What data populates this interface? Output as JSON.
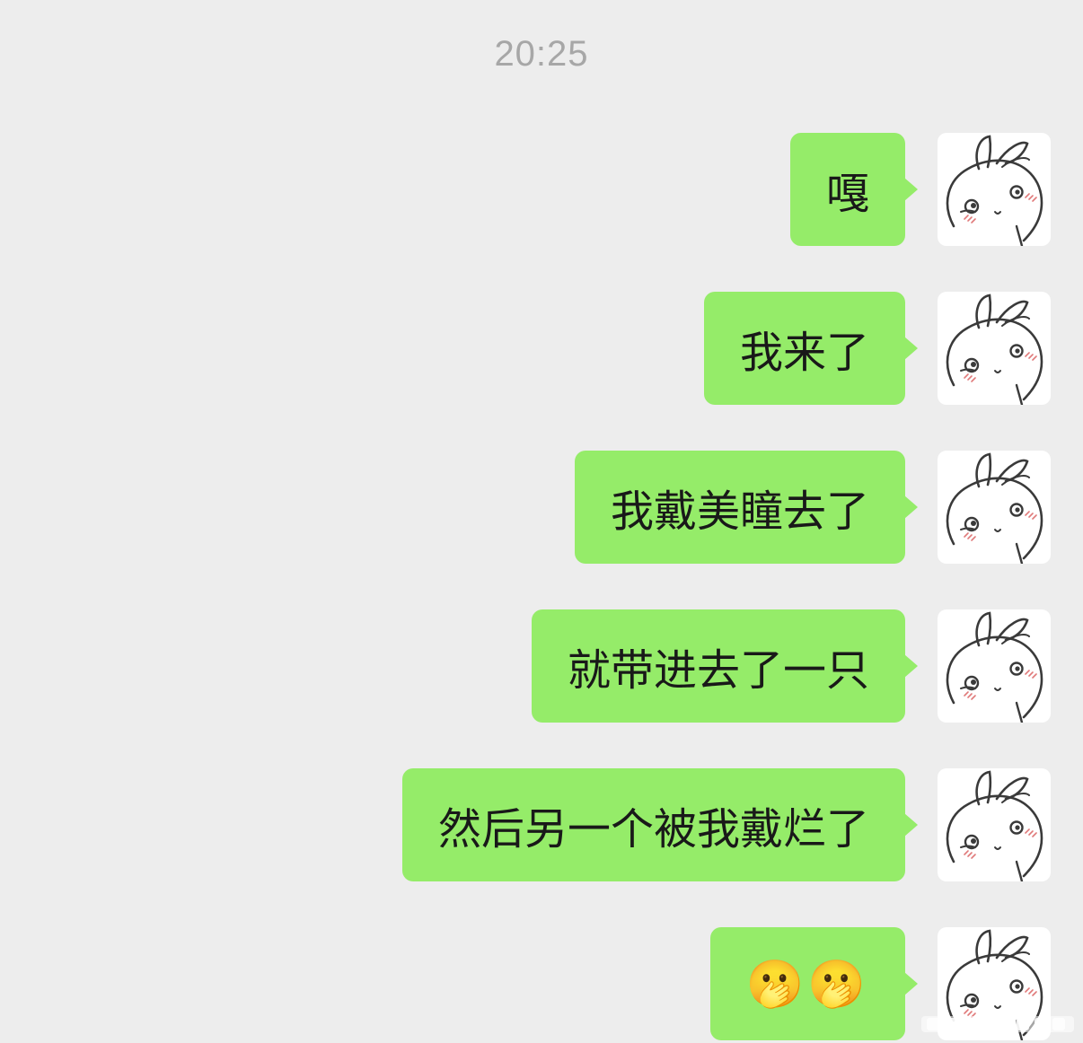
{
  "chat": {
    "timestamp": "20:25",
    "messages": [
      {
        "text": "嘎",
        "sender": "self",
        "type": "text"
      },
      {
        "text": "我来了",
        "sender": "self",
        "type": "text"
      },
      {
        "text": "我戴美瞳去了",
        "sender": "self",
        "type": "text"
      },
      {
        "text": "就带进去了一只",
        "sender": "self",
        "type": "text"
      },
      {
        "text": "然后另一个被我戴烂了",
        "sender": "self",
        "type": "text"
      },
      {
        "text": "🫢🫢",
        "sender": "self",
        "type": "emoji"
      }
    ],
    "avatar_icon": "bunny-avatar-icon"
  },
  "colors": {
    "background": "#ededed",
    "bubble_self": "#95ec69",
    "timestamp_text": "#a7a7a7",
    "message_text": "#191919"
  }
}
